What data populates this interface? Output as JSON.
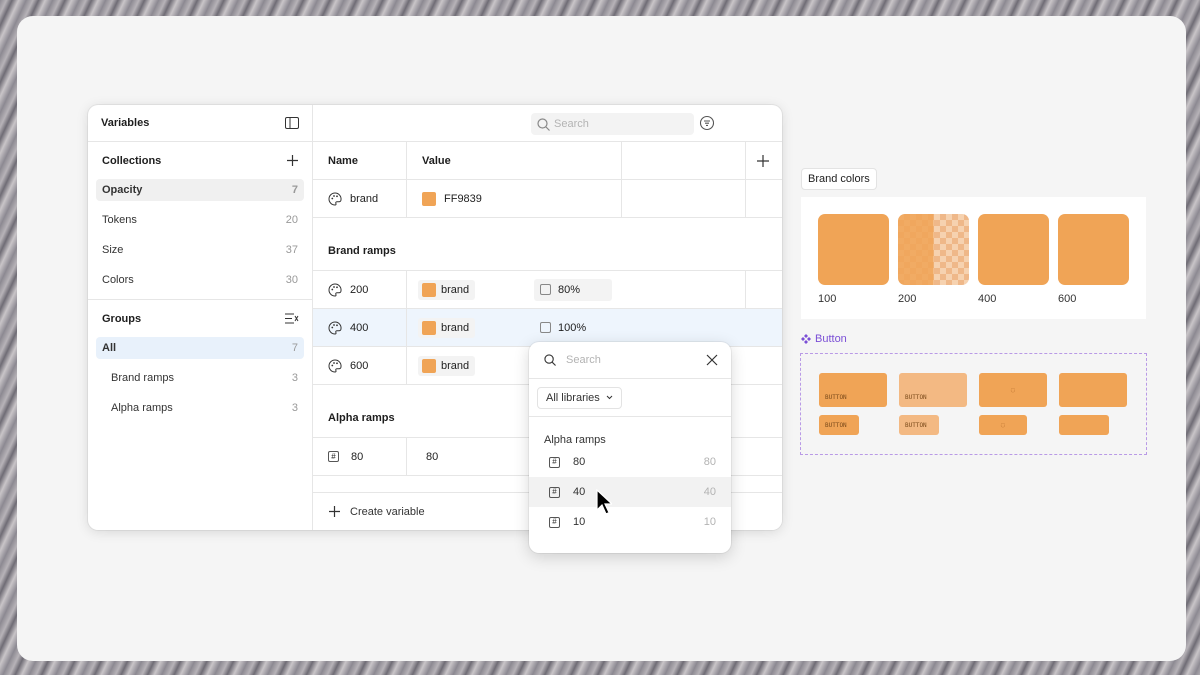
{
  "panel": {
    "title": "Variables",
    "collections_title": "Collections",
    "collections": [
      {
        "label": "Opacity",
        "count": "7"
      },
      {
        "label": "Tokens",
        "count": "20"
      },
      {
        "label": "Size",
        "count": "37"
      },
      {
        "label": "Colors",
        "count": "30"
      }
    ],
    "groups_title": "Groups",
    "groups": [
      {
        "label": "All",
        "count": "7"
      },
      {
        "label": "Brand ramps",
        "count": "3"
      },
      {
        "label": "Alpha ramps",
        "count": "3"
      }
    ],
    "search_placeholder": "Search",
    "columns": {
      "name": "Name",
      "value": "Value"
    },
    "brand_row": {
      "name": "brand",
      "value": "FF9839"
    },
    "brand_ramps_title": "Brand ramps",
    "brand_ramps": [
      {
        "name": "200",
        "alias": "brand",
        "opacity": "80%"
      },
      {
        "name": "400",
        "alias": "brand",
        "opacity": "100%"
      },
      {
        "name": "600",
        "alias": "brand"
      }
    ],
    "alpha_ramps_title": "Alpha ramps",
    "alpha_ramps": [
      {
        "name": "80",
        "value": "80"
      }
    ],
    "create_label": "Create variable"
  },
  "popover": {
    "search_placeholder": "Search",
    "library_filter": "All libraries",
    "section_title": "Alpha ramps",
    "items": [
      {
        "label": "80",
        "value": "80"
      },
      {
        "label": "40",
        "value": "40"
      },
      {
        "label": "10",
        "value": "10"
      }
    ]
  },
  "canvas": {
    "brand_colors_label": "Brand colors",
    "swatch_labels": [
      "100",
      "200",
      "400",
      "600"
    ],
    "button_component_label": "Button",
    "button_text": "BUTTON"
  },
  "colors": {
    "brand": "#F0A456",
    "selection": "#EEF5FD",
    "component": "#7B4FD6"
  }
}
